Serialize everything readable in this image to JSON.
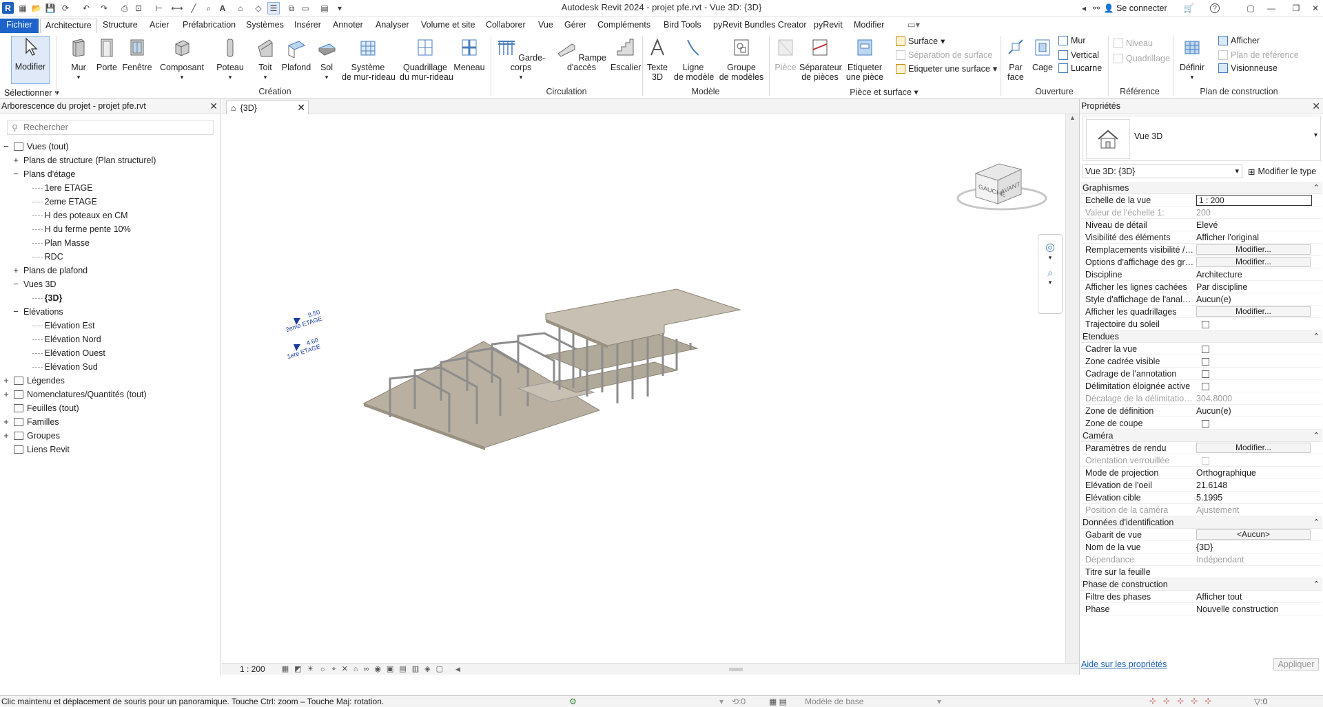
{
  "titlebar": {
    "title": "Autodesk Revit 2024 - projet pfe.rvt - Vue 3D: {3D}",
    "signin": "Se connecter",
    "help": "?"
  },
  "tabs": [
    "Fichier",
    "Architecture",
    "Structure",
    "Acier",
    "Préfabrication",
    "Systèmes",
    "Insérer",
    "Annoter",
    "Analyser",
    "Volume et site",
    "Collaborer",
    "Vue",
    "Gérer",
    "Compléments",
    "Bird Tools",
    "pyRevit Bundles Creator",
    "pyRevit",
    "Modifier"
  ],
  "ribbon": {
    "modify": "Modifier",
    "select": "Sélectionner",
    "creation": {
      "label": "Création",
      "buttons": [
        "Mur",
        "Porte",
        "Fenêtre",
        "Composant",
        "Poteau",
        "Toit",
        "Plafond",
        "Sol",
        "Système\nde mur-rideau",
        "Quadrillage\ndu mur-rideau",
        "Meneau"
      ]
    },
    "circulation": {
      "label": "Circulation",
      "buttons": [
        "Garde-corps",
        "Rampe d'accès",
        "Escalier"
      ]
    },
    "modele": {
      "label": "Modèle",
      "buttons": [
        "Texte\n3D",
        "Ligne\nde modèle",
        "Groupe\nde modèles"
      ]
    },
    "piece": {
      "label": "Pièce et surface",
      "buttons": [
        "Pièce",
        "Séparateur\nde pièces",
        "Etiqueter\nune pièce"
      ],
      "small": [
        "Surface",
        "Séparation de surface",
        "Etiqueter une surface"
      ]
    },
    "ouverture": {
      "label": "Ouverture",
      "buttons": [
        "Par\nface",
        "Cage"
      ],
      "small": [
        "Mur",
        "Vertical",
        "Lucarne"
      ]
    },
    "reference": {
      "label": "Référence",
      "small": [
        "Niveau",
        "Quadrillage"
      ]
    },
    "plan": {
      "label": "Plan de construction",
      "buttons": [
        "Définir"
      ],
      "small": [
        "Afficher",
        "Plan de référence",
        "Visionneuse"
      ]
    }
  },
  "browser": {
    "title": "Arborescence du projet - projet pfe.rvt",
    "search_placeholder": "Rechercher",
    "items": [
      {
        "label": "Vues (tout)",
        "level": 0,
        "toggle": "−"
      },
      {
        "label": "Plans de structure (Plan structurel)",
        "level": 1,
        "toggle": "+"
      },
      {
        "label": "Plans d'étage",
        "level": 1,
        "toggle": "−"
      },
      {
        "label": "1ere ETAGE",
        "level": 2,
        "toggle": ""
      },
      {
        "label": "2eme ETAGE",
        "level": 2,
        "toggle": ""
      },
      {
        "label": "H des poteaux en CM",
        "level": 2,
        "toggle": ""
      },
      {
        "label": "H du ferme pente 10%",
        "level": 2,
        "toggle": ""
      },
      {
        "label": "Plan Masse",
        "level": 2,
        "toggle": ""
      },
      {
        "label": "RDC",
        "level": 2,
        "toggle": ""
      },
      {
        "label": "Plans de plafond",
        "level": 1,
        "toggle": "+"
      },
      {
        "label": "Vues 3D",
        "level": 1,
        "toggle": "−"
      },
      {
        "label": "{3D}",
        "level": 2,
        "toggle": "",
        "bold": true
      },
      {
        "label": "Elévations",
        "level": 1,
        "toggle": "−"
      },
      {
        "label": "Elévation Est",
        "level": 2,
        "toggle": ""
      },
      {
        "label": "Elévation Nord",
        "level": 2,
        "toggle": ""
      },
      {
        "label": "Elévation Ouest",
        "level": 2,
        "toggle": ""
      },
      {
        "label": "Elévation Sud",
        "level": 2,
        "toggle": ""
      },
      {
        "label": "Légendes",
        "level": 0,
        "toggle": "+"
      },
      {
        "label": "Nomenclatures/Quantités (tout)",
        "level": 0,
        "toggle": "+"
      },
      {
        "label": "Feuilles (tout)",
        "level": 0,
        "toggle": ""
      },
      {
        "label": "Familles",
        "level": 0,
        "toggle": "+"
      },
      {
        "label": "Groupes",
        "level": 0,
        "toggle": "+"
      },
      {
        "label": "Liens Revit",
        "level": 0,
        "toggle": ""
      }
    ]
  },
  "view": {
    "tab": "{3D}",
    "levels": [
      {
        "elev": "8.50",
        "name": "2eme ETAGE"
      },
      {
        "elev": "4.60",
        "name": "1ere ETAGE"
      }
    ],
    "navcube": {
      "left": "GAUCHE",
      "front": "AVANT",
      "top": "HAUT"
    },
    "scale": "1 : 200"
  },
  "properties": {
    "title": "Propriétés",
    "type": "Vue 3D",
    "instance": "Vue 3D: {3D}",
    "edit_type": "Modifier le type",
    "sections": [
      {
        "name": "Graphismes",
        "rows": [
          {
            "k": "Echelle de la vue",
            "v": "1 : 200",
            "kind": "input"
          },
          {
            "k": "Valeur de l'échelle    1:",
            "v": "200",
            "kind": "text",
            "dis": true
          },
          {
            "k": "Niveau de détail",
            "v": "Elevé",
            "kind": "text"
          },
          {
            "k": "Visibilité des éléments",
            "v": "Afficher l'original",
            "kind": "text"
          },
          {
            "k": "Remplacements visibilité / g...",
            "v": "Modifier...",
            "kind": "btn"
          },
          {
            "k": "Options d'affichage des grap...",
            "v": "Modifier...",
            "kind": "btn"
          },
          {
            "k": "Discipline",
            "v": "Architecture",
            "kind": "text"
          },
          {
            "k": "Afficher les lignes cachées",
            "v": "Par discipline",
            "kind": "text"
          },
          {
            "k": "Style d'affichage de l'analyse...",
            "v": "Aucun(e)",
            "kind": "text"
          },
          {
            "k": "Afficher les quadrillages",
            "v": "Modifier...",
            "kind": "btn"
          },
          {
            "k": "Trajectoire du soleil",
            "v": "",
            "kind": "cb"
          }
        ]
      },
      {
        "name": "Etendues",
        "rows": [
          {
            "k": "Cadrer la vue",
            "v": "",
            "kind": "cb"
          },
          {
            "k": "Zone cadrée visible",
            "v": "",
            "kind": "cb"
          },
          {
            "k": "Cadrage de l'annotation",
            "v": "",
            "kind": "cb"
          },
          {
            "k": "Délimitation éloignée active",
            "v": "",
            "kind": "cb"
          },
          {
            "k": "Décalage de la délimitation é...",
            "v": "304.8000",
            "kind": "text",
            "dis": true
          },
          {
            "k": "Zone de définition",
            "v": "Aucun(e)",
            "kind": "text"
          },
          {
            "k": "Zone de coupe",
            "v": "",
            "kind": "cb"
          }
        ]
      },
      {
        "name": "Caméra",
        "rows": [
          {
            "k": "Paramètres de rendu",
            "v": "Modifier...",
            "kind": "btn"
          },
          {
            "k": "Orientation verrouillée",
            "v": "",
            "kind": "cb",
            "dis": true
          },
          {
            "k": "Mode de projection",
            "v": "Orthographique",
            "kind": "text"
          },
          {
            "k": "Elévation de l'oeil",
            "v": "21.6148",
            "kind": "text"
          },
          {
            "k": "Elévation cible",
            "v": "5.1995",
            "kind": "text"
          },
          {
            "k": "Position de la caméra",
            "v": "Ajustement",
            "kind": "text",
            "dis": true
          }
        ]
      },
      {
        "name": "Données d'identification",
        "rows": [
          {
            "k": "Gabarit de vue",
            "v": "<Aucun>",
            "kind": "btn"
          },
          {
            "k": "Nom de la vue",
            "v": "{3D}",
            "kind": "text"
          },
          {
            "k": "Dépendance",
            "v": "Indépendant",
            "kind": "text",
            "dis": true
          },
          {
            "k": "Titre sur la feuille",
            "v": "",
            "kind": "text"
          }
        ]
      },
      {
        "name": "Phase de construction",
        "rows": [
          {
            "k": "Filtre des phases",
            "v": "Afficher tout",
            "kind": "text"
          },
          {
            "k": "Phase",
            "v": "Nouvelle construction",
            "kind": "text"
          }
        ]
      }
    ],
    "help_link": "Aide sur les propriétés",
    "apply": "Appliquer"
  },
  "status": {
    "text": "Clic maintenu et déplacement de souris pour un panoramique. Touche Ctrl: zoom – Touche Maj: rotation.",
    "model": "Modèle de base",
    "count1": ":0",
    "count2": ":0"
  }
}
